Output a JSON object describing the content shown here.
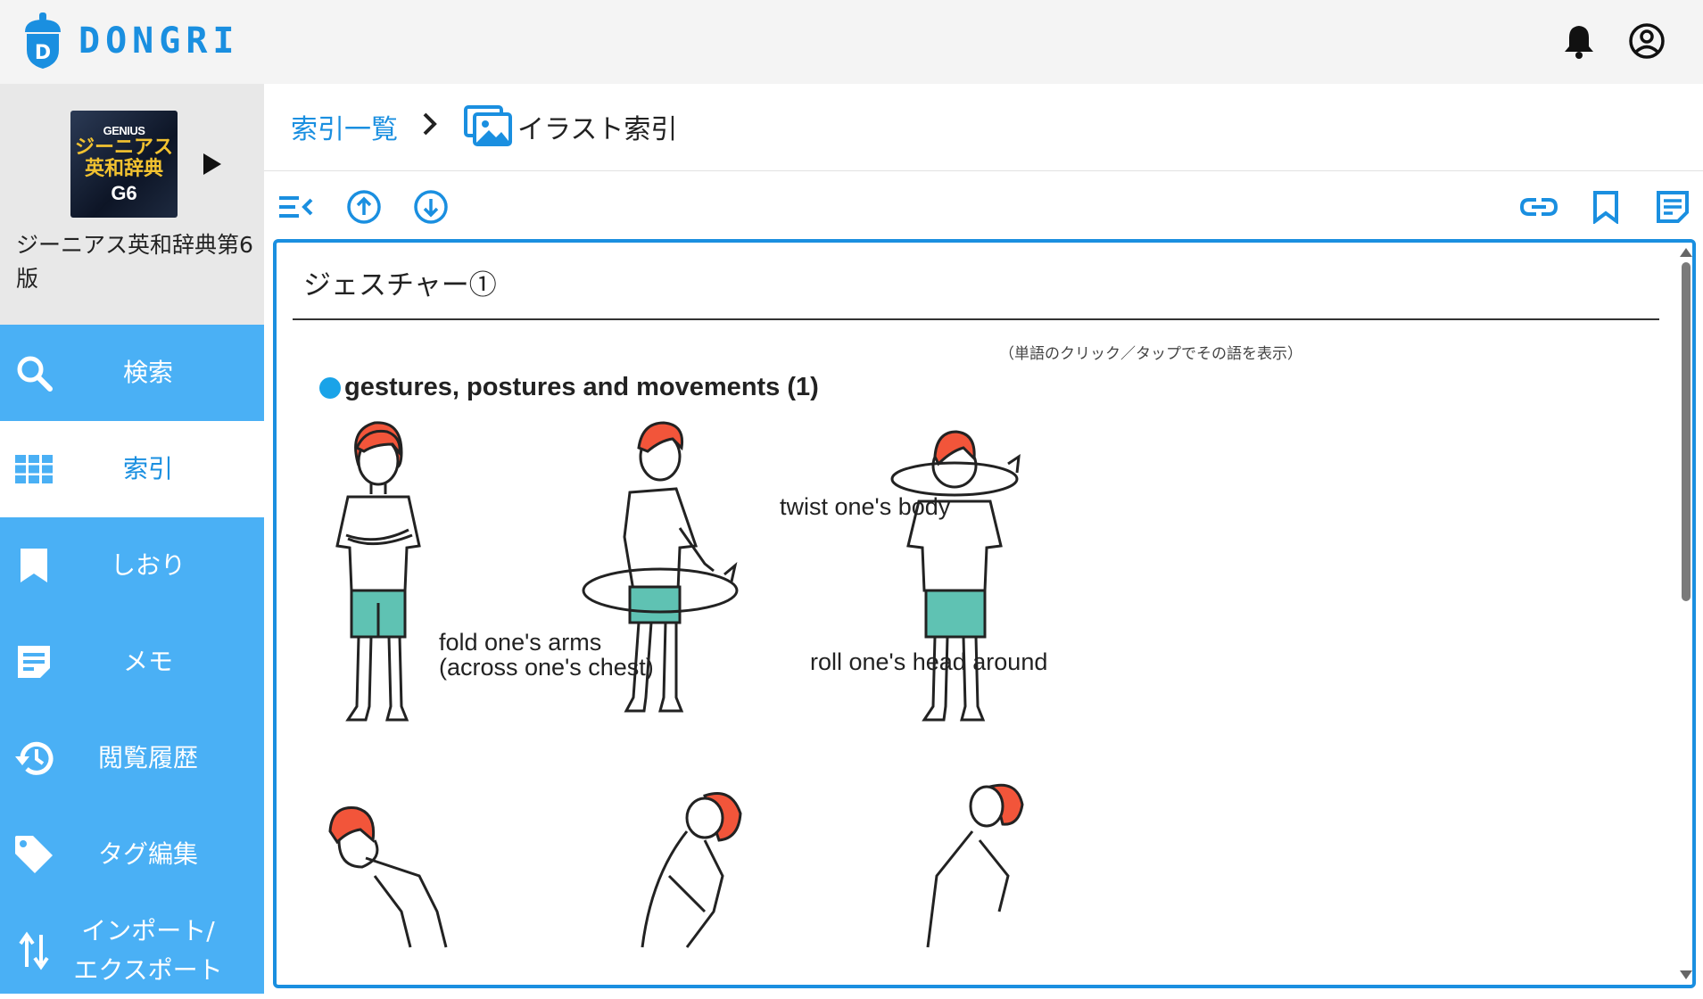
{
  "app": {
    "name": "DONGRI",
    "logo_letter": "D"
  },
  "header": {
    "icons": [
      "bell-icon",
      "account-circle-icon"
    ]
  },
  "book": {
    "cover": {
      "brand": "GENIUS",
      "title_line1": "ジーニアス",
      "title_line2": "英和辞典",
      "edition": "G6"
    },
    "name": "ジーニアス英和辞典第6版"
  },
  "sidebar": {
    "items": [
      {
        "label": "検索",
        "icon": "search-icon",
        "active": false
      },
      {
        "label": "索引",
        "icon": "grid-icon",
        "active": true
      },
      {
        "label": "しおり",
        "icon": "bookmark-icon",
        "active": false
      },
      {
        "label": "メモ",
        "icon": "memo-icon",
        "active": false
      },
      {
        "label": "閲覧履歴",
        "icon": "history-icon",
        "active": false
      },
      {
        "label": "タグ編集",
        "icon": "tag-icon",
        "active": false
      },
      {
        "label_line1": "インポート/",
        "label_line2": "エクスポート",
        "icon": "import-export-icon",
        "active": false
      }
    ]
  },
  "breadcrumb": {
    "parent": "索引一覧",
    "current": "イラスト索引"
  },
  "toolbar": {
    "left": [
      "collapse-list-icon",
      "arrow-up-circle-icon",
      "arrow-down-circle-icon"
    ],
    "right": [
      "link-icon",
      "bookmark-outline-icon",
      "memo-outline-icon"
    ]
  },
  "content": {
    "title": "ジェスチャー①",
    "hint": "（単語のクリック／タップでその語を表示）",
    "section": "gestures, postures and movements (1)",
    "labels": {
      "fold_line1": "fold one's arms",
      "fold_line2": "(across one's chest)",
      "twist": "twist one's body",
      "roll": "roll one's head around"
    }
  },
  "colors": {
    "accent": "#1a8fe0",
    "sidebar": "#4ab0f5",
    "hair": "#f2553a",
    "shorts": "#5fc2b3"
  }
}
